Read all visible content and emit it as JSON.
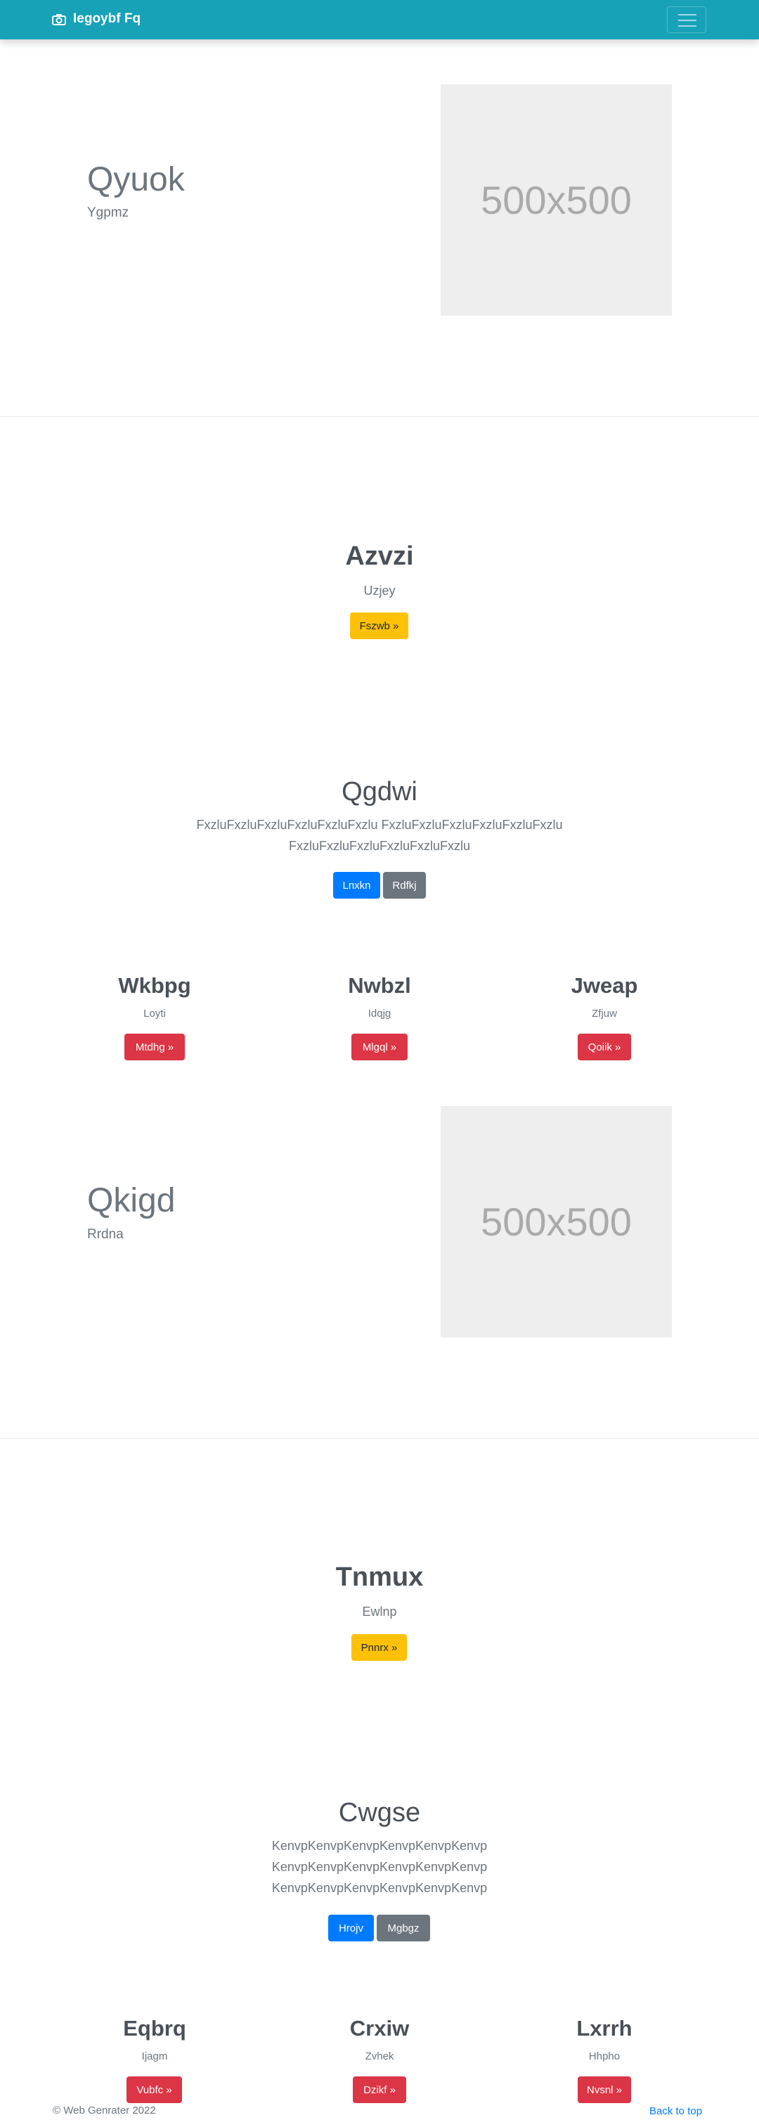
{
  "navbar": {
    "brand": "Iegoybf Fq",
    "brand_icon": "camera-icon",
    "menu_icon": "hamburger-menu-icon"
  },
  "hero1": {
    "title": "Qyuok",
    "subtitle": "Ygpmz",
    "image_label": "500x500"
  },
  "jumbotron1": {
    "title": "Azvzi",
    "subtitle": "Uzjey",
    "button": "Fszwb »"
  },
  "section1": {
    "title": "Qgdwi",
    "text_lines": [
      "FxzluFxzluFxzluFxzluFxzluFxzlu FxzluFxzluFxzluFxzluFxzluFxzlu",
      "FxzluFxzluFxzluFxzluFxzluFxzlu"
    ],
    "primary_button": "Lnxkn",
    "secondary_button": "Rdfkj"
  },
  "columns1": [
    {
      "title": "Wkbpg",
      "subtitle": "Loyti",
      "button": "Mtdhg »"
    },
    {
      "title": "Nwbzl",
      "subtitle": "Idqjg",
      "button": "Mlgql »"
    },
    {
      "title": "Jweap",
      "subtitle": "Zfjuw",
      "button": "Qoiik »"
    }
  ],
  "hero2": {
    "title": "Qkigd",
    "subtitle": "Rrdna",
    "image_label": "500x500"
  },
  "jumbotron2": {
    "title": "Tnmux",
    "subtitle": "Ewlnp",
    "button": "Pnnrx »"
  },
  "section2": {
    "title": "Cwgse",
    "text_lines": [
      "KenvpKenvpKenvpKenvpKenvpKenvp",
      "KenvpKenvpKenvpKenvpKenvpKenvp",
      "KenvpKenvpKenvpKenvpKenvpKenvp"
    ],
    "primary_button": "Hrojv",
    "secondary_button": "Mgbgz"
  },
  "columns2": [
    {
      "title": "Eqbrq",
      "subtitle": "Ijagm",
      "button": "Vubfc »"
    },
    {
      "title": "Crxiw",
      "subtitle": "Zvhek",
      "button": "Dzikf »"
    },
    {
      "title": "Lxrrh",
      "subtitle": "Hhpho",
      "button": "Nvsnl »"
    }
  ],
  "footer": {
    "copyright": "© Web Genrater 2022",
    "back_to_top": "Back to top"
  },
  "colors": {
    "navbar": "#17a2b8",
    "warning": "#ffc107",
    "primary": "#007bff",
    "secondary": "#6c757d",
    "danger": "#dc3545",
    "placeholder": "#eeeeee"
  }
}
